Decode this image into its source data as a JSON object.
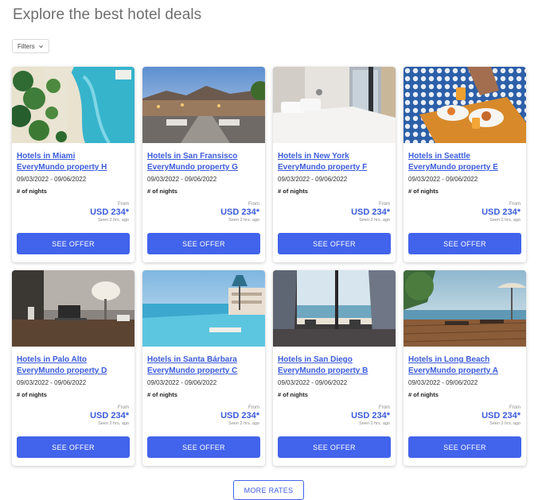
{
  "page": {
    "title": "Explore the best hotel deals"
  },
  "filters": {
    "label": "Filters",
    "icon": "chevron-down-icon"
  },
  "cards": [
    {
      "city": "Hotels in Miami",
      "property": "EveryMundo property H",
      "dates": "09/03/2022 - 09/06/2022",
      "nights": "# of nights",
      "from": "From",
      "price": "USD 234*",
      "seen": "Seen 2 hrs. ago",
      "button": "SEE OFFER",
      "image": "pool-aerial"
    },
    {
      "city": "Hotels in San Fransisco",
      "property": "EveryMundo property G",
      "dates": "09/03/2022 - 09/06/2022",
      "nights": "# of nights",
      "from": "From",
      "price": "USD 234*",
      "seen": "Seen 2 hrs. ago",
      "button": "SEE OFFER",
      "image": "hillside-city"
    },
    {
      "city": "Hotels in New York",
      "property": "EveryMundo property F",
      "dates": "09/03/2022 - 09/06/2022",
      "nights": "# of nights",
      "from": "From",
      "price": "USD 234*",
      "seen": "Seen 2 hrs. ago",
      "button": "SEE OFFER",
      "image": "bedroom"
    },
    {
      "city": "Hotels in Seattle",
      "property": "EveryMundo property E",
      "dates": "09/03/2022 - 09/06/2022",
      "nights": "# of nights",
      "from": "From",
      "price": "USD 234*",
      "seen": "Seen 2 hrs. ago",
      "button": "SEE OFFER",
      "image": "breakfast-tray"
    },
    {
      "city": "Hotels in Palo Alto",
      "property": "EveryMundo property D",
      "dates": "09/03/2022 - 09/06/2022",
      "nights": "# of nights",
      "from": "From",
      "price": "USD 234*",
      "seen": "Seen 2 hrs. ago",
      "button": "SEE OFFER",
      "image": "desk-lamp"
    },
    {
      "city": "Hotels in Santa Bárbara",
      "property": "EveryMundo property C",
      "dates": "09/03/2022 - 09/06/2022",
      "nights": "# of nights",
      "from": "From",
      "price": "USD 234*",
      "seen": "Seen 2 hrs. ago",
      "button": "SEE OFFER",
      "image": "infinity-pool"
    },
    {
      "city": "Hotels in San Diego",
      "property": "EveryMundo property B",
      "dates": "09/03/2022 - 09/06/2022",
      "nights": "# of nights",
      "from": "From",
      "price": "USD 234*",
      "seen": "Seen 2 hrs. ago",
      "button": "SEE OFFER",
      "image": "ocean-window"
    },
    {
      "city": "Hotels in Long Beach",
      "property": "EveryMundo property A",
      "dates": "09/03/2022 - 09/06/2022",
      "nights": "# of nights",
      "from": "From",
      "price": "USD 234*",
      "seen": "Seen 2 hrs. ago",
      "button": "SEE OFFER",
      "image": "beach-deck"
    }
  ],
  "more_button": {
    "label": "MORE RATES"
  },
  "colors": {
    "accent": "#4263eb",
    "link": "#3b5bdb",
    "title": "#6e6e6e"
  }
}
